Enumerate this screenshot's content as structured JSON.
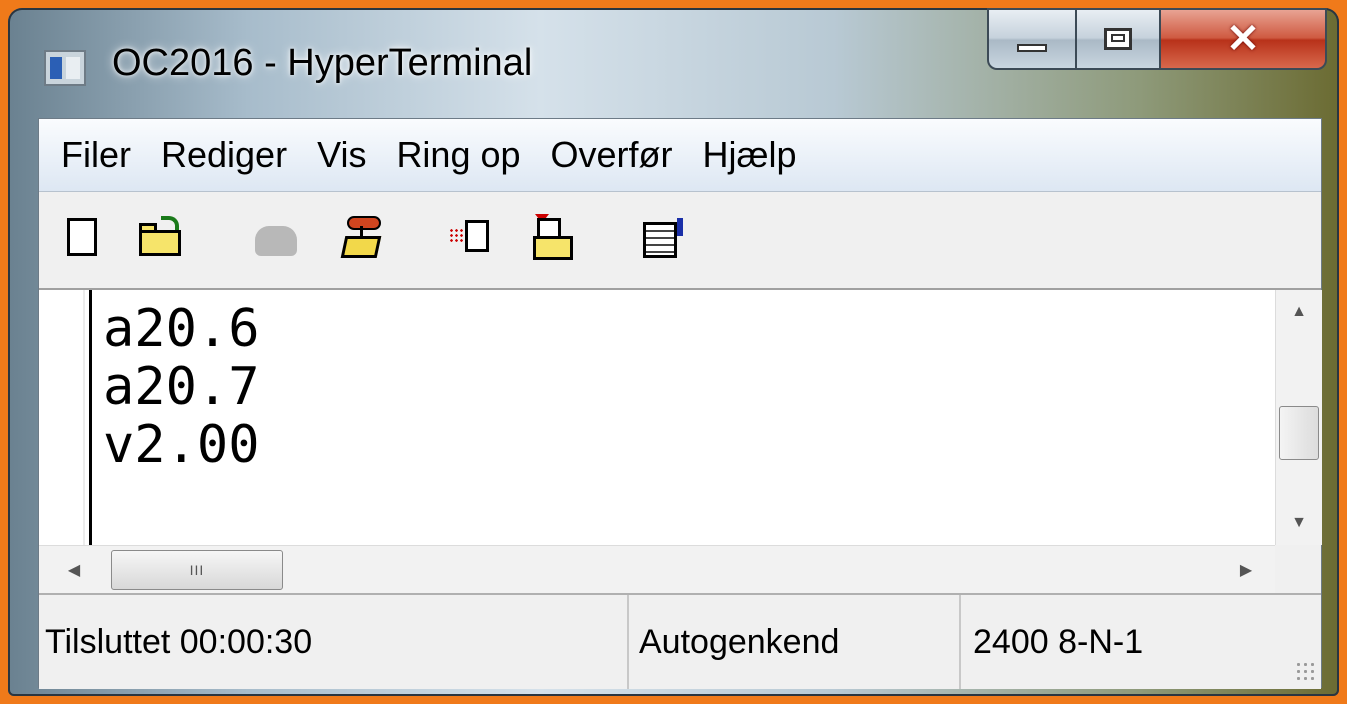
{
  "window": {
    "title": "OC2016 - HyperTerminal",
    "controls": {
      "minimize": "minimize",
      "maximize": "maximize",
      "close": "close"
    }
  },
  "menu": {
    "items": [
      "Filer",
      "Rediger",
      "Vis",
      "Ring op",
      "Overfør",
      "Hjælp"
    ]
  },
  "toolbar": {
    "icons": [
      "new-connection-icon",
      "open-icon",
      "call-icon-disabled",
      "disconnect-icon",
      "send-file-icon",
      "receive-file-icon",
      "properties-icon"
    ]
  },
  "terminal": {
    "lines": [
      "a20.6",
      "a20.7",
      "v2.00"
    ]
  },
  "status": {
    "connection": "Tilsluttet 00:00:30",
    "detection": "Autogenkend",
    "port_settings": "2400 8-N-1"
  },
  "colors": {
    "background_frame": "#f07a1a",
    "close_button": "#cf5a41",
    "menu_bar": "#dde7f3"
  }
}
